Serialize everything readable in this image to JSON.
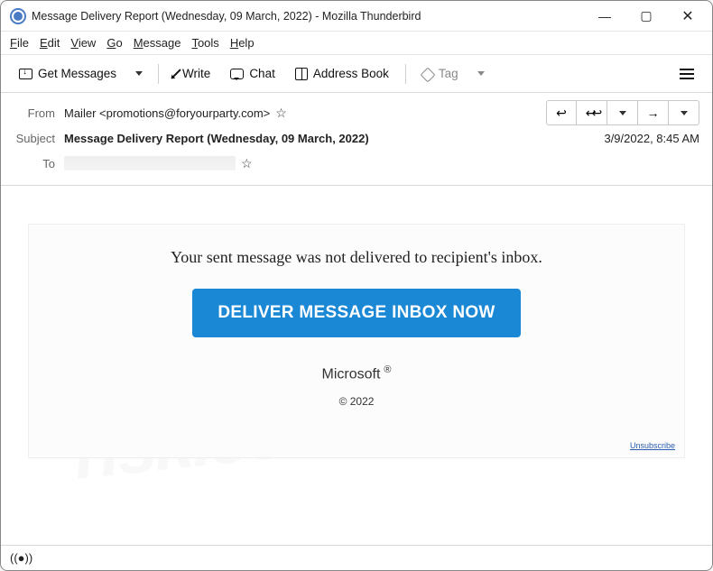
{
  "window": {
    "title": "Message Delivery Report (Wednesday, 09 March, 2022) - Mozilla Thunderbird"
  },
  "menubar": {
    "file": "File",
    "edit": "Edit",
    "view": "View",
    "go": "Go",
    "message": "Message",
    "tools": "Tools",
    "help": "Help"
  },
  "toolbar": {
    "get_messages": "Get Messages",
    "write": "Write",
    "chat": "Chat",
    "address_book": "Address Book",
    "tag": "Tag"
  },
  "header": {
    "from_label": "From",
    "from_value": "Mailer <promotions@foryourparty.com>",
    "subject_label": "Subject",
    "subject_value": "Message Delivery Report (Wednesday, 09 March, 2022)",
    "to_label": "To",
    "date": "3/9/2022, 8:45 AM"
  },
  "body": {
    "headline": "Your sent message was not delivered to recipient's inbox.",
    "button": "DELIVER MESSAGE INBOX NOW",
    "brand": "Microsoft",
    "registered": "®",
    "copyright": "© 2022",
    "unsubscribe": "Unsubscribe"
  },
  "status": {
    "indicator": "((●))"
  }
}
